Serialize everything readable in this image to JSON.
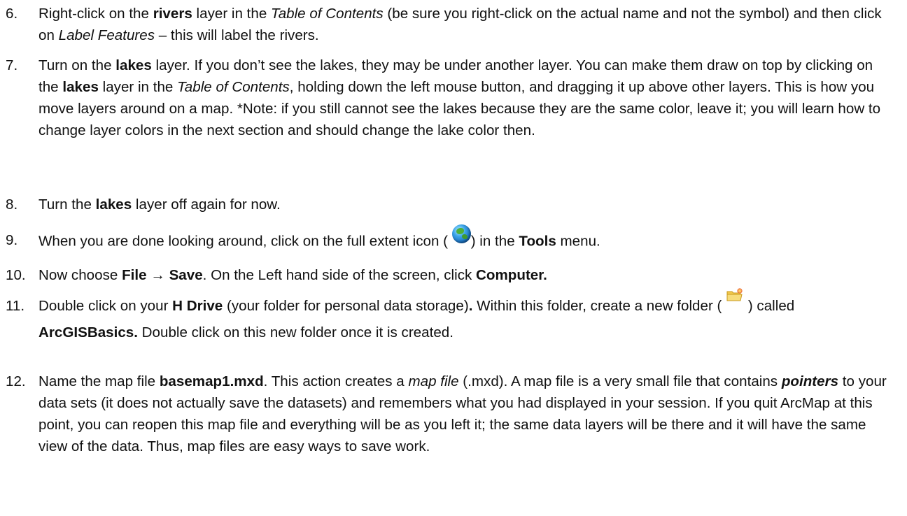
{
  "items": [
    {
      "number": "6.",
      "segments": [
        {
          "t": "Right-click on the "
        },
        {
          "t": "rivers",
          "s": "b"
        },
        {
          "t": " layer in the "
        },
        {
          "t": "Table of Contents",
          "s": "i"
        },
        {
          "t": " (be sure you right-click on the actual name and not the symbol) and then click on "
        },
        {
          "t": "Label Features",
          "s": "i"
        },
        {
          "t": " – this will label the rivers."
        }
      ]
    },
    {
      "number": "7.",
      "segments": [
        {
          "t": "Turn on the "
        },
        {
          "t": "lakes",
          "s": "b"
        },
        {
          "t": " layer.  If you don’t see the lakes, they may be under another layer.  You can make them draw on top by clicking on the "
        },
        {
          "t": "lakes",
          "s": "b"
        },
        {
          "t": " layer in the "
        },
        {
          "t": "Table of Contents",
          "s": "i"
        },
        {
          "t": ", holding down the left mouse button, and dragging it up above other layers.  This is how you move layers around on a map. *Note: if you still cannot see the lakes because they are the same color, leave it; you will learn how to change layer colors in the next section and should change the lake color then."
        }
      ]
    },
    {
      "number": "8.",
      "segments": [
        {
          "t": "Turn the "
        },
        {
          "t": "lakes",
          "s": "b"
        },
        {
          "t": " layer off again for now."
        }
      ]
    },
    {
      "number": "9.",
      "segments": [
        {
          "t": "When you are done looking around, click on the full extent icon ( "
        },
        {
          "icon": "globe-icon"
        },
        {
          "t": ") in the "
        },
        {
          "t": "Tools",
          "s": "b"
        },
        {
          "t": " menu."
        }
      ]
    },
    {
      "number": "10.",
      "segments": [
        {
          "t": "Now choose "
        },
        {
          "t": "File → Save",
          "s": "b"
        },
        {
          "t": ".  On the Left hand side of the screen, click "
        },
        {
          "t": "Computer.",
          "s": "b"
        }
      ]
    },
    {
      "number": "11.",
      "segments": [
        {
          "t": "Double click on your "
        },
        {
          "t": "H Drive",
          "s": "b"
        },
        {
          "t": " (your folder for personal data storage)"
        },
        {
          "t": ".",
          "s": "b"
        },
        {
          "t": " Within this folder, create a new folder ( "
        },
        {
          "icon": "new-folder-icon"
        },
        {
          "t": " ) called "
        },
        {
          "t": "ArcGISBasics.",
          "s": "b"
        },
        {
          "t": " Double click on this new folder once it is created."
        }
      ]
    },
    {
      "number": "12.",
      "segments": [
        {
          "t": "Name the map file "
        },
        {
          "t": "basemap1.mxd",
          "s": "b"
        },
        {
          "t": ".  This action creates a "
        },
        {
          "t": "map file",
          "s": "i"
        },
        {
          "t": " (.mxd).  A map file is a very small file that contains "
        },
        {
          "t": "pointers",
          "s": "bi"
        },
        {
          "t": " to your data sets (it does not actually save the datasets) and remembers what you had displayed in your session.  If you quit ArcMap at this point, you can reopen this map file and everything will be as you left it; the same data layers will be there and it will have the same view of the data.  Thus, map files are easy ways to save work."
        }
      ]
    }
  ]
}
